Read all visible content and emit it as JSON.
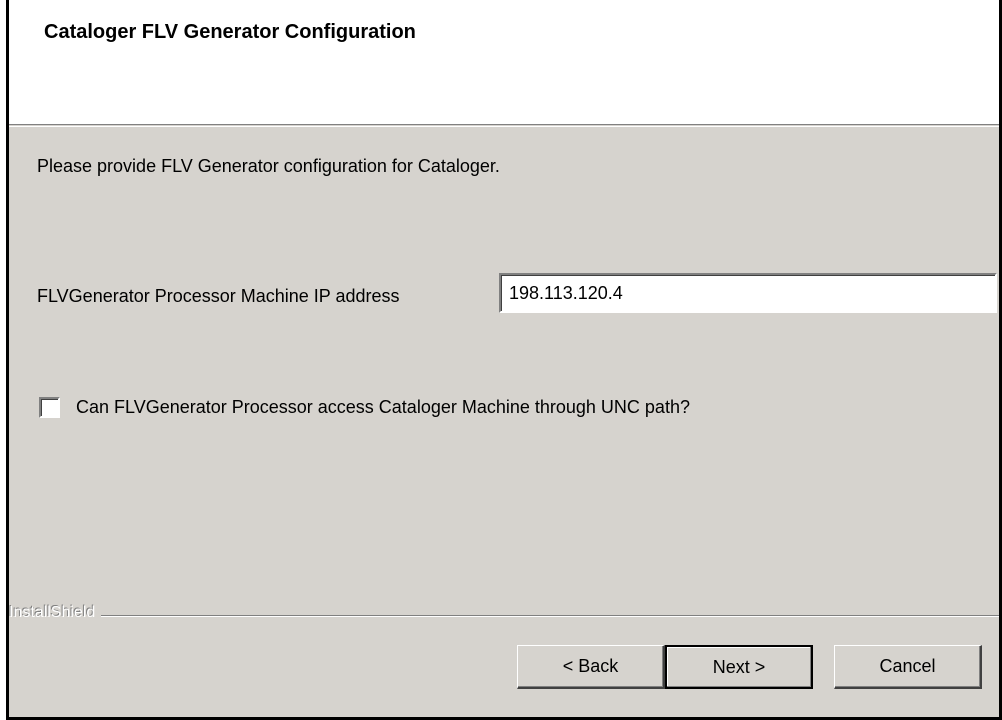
{
  "header": {
    "title": "Cataloger FLV Generator Configuration"
  },
  "main": {
    "description": "Please provide FLV Generator configuration for Cataloger.",
    "ip_label": "FLVGenerator Processor Machine IP address",
    "ip_value": "198.113.120.4",
    "unc_checkbox": {
      "label": "Can FLVGenerator Processor access Cataloger Machine through UNC path?",
      "checked": false
    }
  },
  "footer": {
    "brand": "InstallShield",
    "back_label": "< Back",
    "next_label": "Next >",
    "cancel_label": "Cancel"
  }
}
